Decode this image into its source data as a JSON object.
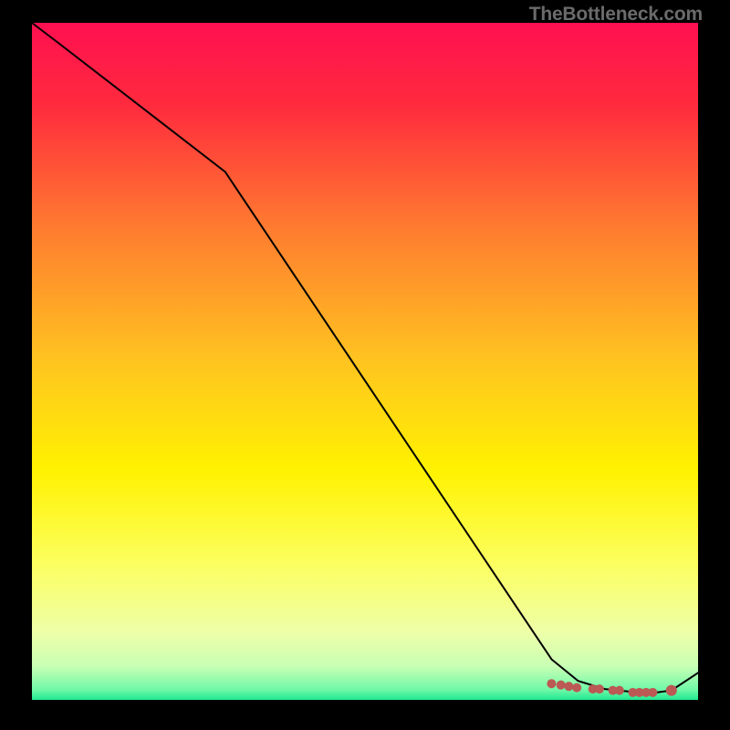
{
  "watermark": "TheBottleneck.com",
  "chart_data": {
    "type": "line",
    "title": "",
    "xlabel": "",
    "ylabel": "",
    "xlim": [
      0,
      100
    ],
    "ylim": [
      0,
      100
    ],
    "grid": false,
    "background_gradient": {
      "type": "vertical",
      "stops": [
        {
          "pos": 0.0,
          "color": "#ff1050"
        },
        {
          "pos": 0.12,
          "color": "#ff2a3e"
        },
        {
          "pos": 0.3,
          "color": "#ff7a30"
        },
        {
          "pos": 0.5,
          "color": "#ffc420"
        },
        {
          "pos": 0.66,
          "color": "#fff200"
        },
        {
          "pos": 0.8,
          "color": "#fcff60"
        },
        {
          "pos": 0.9,
          "color": "#eeffa8"
        },
        {
          "pos": 0.95,
          "color": "#c9ffb4"
        },
        {
          "pos": 0.985,
          "color": "#70f8a8"
        },
        {
          "pos": 1.0,
          "color": "#20e890"
        }
      ]
    },
    "series": [
      {
        "name": "bottleneck-curve",
        "stroke": "#000000",
        "x": [
          0,
          4,
          29,
          78,
          82,
          86,
          90,
          93,
          96,
          100
        ],
        "y": [
          100,
          97,
          78,
          6,
          2.8,
          1.6,
          1.2,
          1,
          1.4,
          4
        ]
      }
    ],
    "markers": {
      "name": "marker-dots",
      "color": "#bb5954",
      "points": [
        {
          "x": 78.0,
          "y": 2.4,
          "r": 5
        },
        {
          "x": 79.4,
          "y": 2.2,
          "r": 5
        },
        {
          "x": 80.6,
          "y": 2.0,
          "r": 5
        },
        {
          "x": 81.8,
          "y": 1.8,
          "r": 5
        },
        {
          "x": 84.2,
          "y": 1.6,
          "r": 5
        },
        {
          "x": 85.2,
          "y": 1.6,
          "r": 5
        },
        {
          "x": 87.2,
          "y": 1.4,
          "r": 5
        },
        {
          "x": 88.2,
          "y": 1.4,
          "r": 5
        },
        {
          "x": 90.2,
          "y": 1.1,
          "r": 5
        },
        {
          "x": 91.2,
          "y": 1.1,
          "r": 5
        },
        {
          "x": 92.2,
          "y": 1.1,
          "r": 5
        },
        {
          "x": 93.2,
          "y": 1.1,
          "r": 5
        },
        {
          "x": 96.0,
          "y": 1.4,
          "r": 6
        }
      ]
    }
  }
}
